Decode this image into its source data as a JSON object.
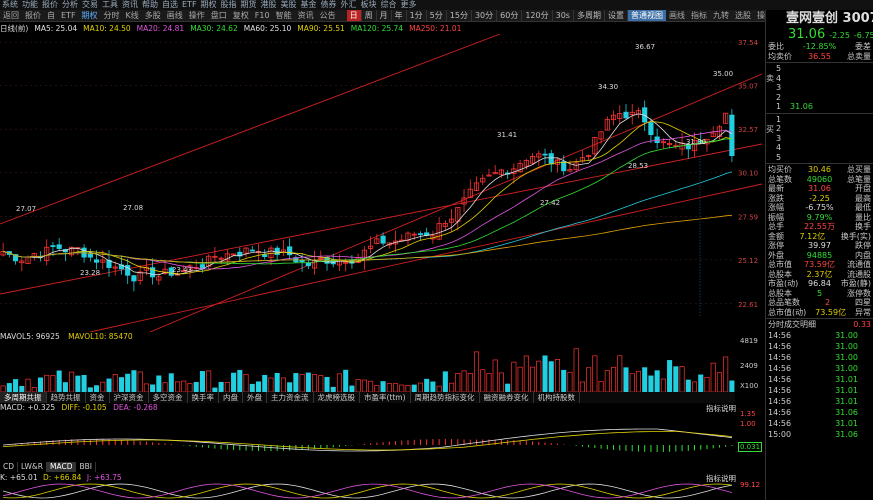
{
  "top_menu": [
    "系统",
    "功能",
    "报价",
    "分析",
    "交易",
    "工具",
    "资讯",
    "帮助",
    "自选",
    "ETF",
    "期权",
    "股指",
    "期货",
    "港股",
    "美股",
    "基金",
    "债券",
    "外汇",
    "板块",
    "综合",
    "更多"
  ],
  "toolbar": {
    "buttons": [
      "返回",
      "报价",
      "自",
      "ETF",
      "期权",
      "分时",
      "K线",
      "多股",
      "画线",
      "操作",
      "盘口",
      "复权",
      "F10",
      "智能",
      "资讯",
      "公告"
    ],
    "periods": [
      "日",
      "周",
      "月",
      "年",
      "1分",
      "5分",
      "15分",
      "30分",
      "60分",
      "120分",
      "30s",
      "多周期",
      "设置"
    ],
    "right_buttons": [
      "普通视图",
      "画线",
      "指标",
      "九转",
      "选股",
      "操作",
      "内",
      "盘口",
      "指数",
      "区间",
      "更多"
    ]
  },
  "ma_header": {
    "prefix": "日线(前)",
    "items": [
      {
        "label": "MA5: 25.04",
        "color": "#e0e0e0"
      },
      {
        "label": "MA10: 24.50",
        "color": "#e0d000"
      },
      {
        "label": "MA20: 24.81",
        "color": "#e055e0"
      },
      {
        "label": "MA30: 24.62",
        "color": "#33dd33"
      },
      {
        "label": "MA60: 25.10",
        "color": "#e0e0e0"
      },
      {
        "label": "MA90: 25.51",
        "color": "#e0d000"
      },
      {
        "label": "MA120: 25.74",
        "color": "#33dd33"
      },
      {
        "label": "MA250: 21.01",
        "color": "#ff4444"
      }
    ]
  },
  "price_axis": [
    "37.54",
    "35.07",
    "32.57",
    "30.10",
    "27.59",
    "25.12",
    "22.61"
  ],
  "annotations": [
    "36.67",
    "35.00",
    "34.30",
    "31.41",
    "31.00",
    "28.53",
    "27.42",
    "27.07",
    "27.08",
    "23.28",
    "23.43"
  ],
  "volume_header": {
    "mavol5": "MAVOL5: 96925",
    "mavol10": "MAVOL10: 85470"
  },
  "volume_axis": [
    "4819",
    "2409",
    "X100"
  ],
  "indicator_tabs": [
    "多周期共振",
    "趋势共振",
    "资金",
    "沪深资金",
    "多空资金",
    "换手率",
    "内盘",
    "外盘",
    "主力资金流",
    "龙虎榜选股",
    "市盈率(ttm)",
    "周期趋势指标变化",
    "融资融券变化",
    "机构持股数"
  ],
  "tab_right_label": "指标说明",
  "macd_header": {
    "macd": "MACD: +0.325",
    "diff": "DIFF: -0.105",
    "dea": "DEA: -0.268"
  },
  "macd_axis": [
    "1.35",
    "1.00",
    "0.031"
  ],
  "kdj_tabs": [
    "CD",
    "LW&R",
    "MACD",
    "BBI"
  ],
  "kdj_header": {
    "k": "K: +65.01",
    "d": "D: +66.84",
    "j": "J: +63.75"
  },
  "kdj_axis": "99.12",
  "kdj_right_label": "指标说明",
  "date_label": "时间段",
  "right_panel": {
    "title": "壹网壹创 300792",
    "price": "31.06",
    "change": "-2.25",
    "change_pct": "-6.75%",
    "webi_label": "委比",
    "webi_value": "-12.85%",
    "weicha_label": "委差",
    "buy_label": "买",
    "sell_label": "卖",
    "avg_label": "均卖价",
    "avg_value": "36.55",
    "total_label": "总卖量",
    "asks": [
      {
        "lvl": "5",
        "price": "",
        "vol": ""
      },
      {
        "lvl": "4",
        "price": "",
        "vol": ""
      },
      {
        "lvl": "3",
        "price": "",
        "vol": ""
      },
      {
        "lvl": "2",
        "price": "",
        "vol": ""
      },
      {
        "lvl": "1",
        "price": "31.06",
        "vol": ""
      }
    ],
    "bids": [
      {
        "lvl": "1",
        "price": "",
        "vol": ""
      },
      {
        "lvl": "2",
        "price": "",
        "vol": ""
      },
      {
        "lvl": "3",
        "price": "",
        "vol": ""
      },
      {
        "lvl": "4",
        "price": "",
        "vol": ""
      },
      {
        "lvl": "5",
        "price": "",
        "vol": ""
      }
    ],
    "avg_buy_label": "均买价",
    "avg_buy_value": "30.46",
    "total_buy_label": "总买量",
    "stats": [
      {
        "k": "总笔数",
        "v": "49060",
        "k2": "总笔量"
      },
      {
        "k": "最新",
        "v": "31.06",
        "k2": "开盘"
      },
      {
        "k": "涨跌",
        "v": "-2.25",
        "k2": "最高"
      },
      {
        "k": "涨幅",
        "v": "-6.75%",
        "k2": "最低"
      },
      {
        "k": "振幅",
        "v": "9.79%",
        "k2": "量比"
      },
      {
        "k": "总手",
        "v": "22.55万",
        "k2": "换手"
      },
      {
        "k": "金额",
        "v": "7.12亿",
        "k2": "换手(实)"
      },
      {
        "k": "涨停",
        "v": "39.97",
        "k2": "跌停"
      },
      {
        "k": "外盘",
        "v": "94885",
        "k2": "内盘"
      },
      {
        "k": "总市值",
        "v": "73.59亿",
        "k2": "流通值"
      },
      {
        "k": "总股本",
        "v": "2.37亿",
        "k2": "流通股"
      },
      {
        "k": "市盈(动)",
        "v": "96.84",
        "k2": "市盈(静)"
      },
      {
        "k": "总股本",
        "v": "5",
        "k2": "涨停数"
      },
      {
        "k": "总品笔数",
        "v": "2",
        "k2": "四星"
      },
      {
        "k": "总市值(动)",
        "v": "73.59亿",
        "k2": "异常"
      }
    ],
    "tick_header": "分时成交明细",
    "tick_extra": "0.33",
    "ticks": [
      {
        "t": "14:56",
        "p": "31.00"
      },
      {
        "t": "14:56",
        "p": "31.00"
      },
      {
        "t": "14:56",
        "p": "31.00"
      },
      {
        "t": "14:56",
        "p": "31.00"
      },
      {
        "t": "14:56",
        "p": "31.01"
      },
      {
        "t": "14:56",
        "p": "31.01"
      },
      {
        "t": "14:56",
        "p": "31.01"
      },
      {
        "t": "14:56",
        "p": "31.06"
      },
      {
        "t": "14:56",
        "p": "31.01"
      },
      {
        "t": "15:00",
        "p": "31.06"
      }
    ]
  },
  "bottom_label": "时间段",
  "chart_data": {
    "type": "candlestick",
    "ylim": [
      21.0,
      38.0
    ],
    "annotations_values": [
      36.67,
      35.0,
      34.3,
      31.41,
      31.0,
      28.53,
      27.42,
      27.07,
      27.08,
      23.28,
      23.43
    ],
    "last_close": 31.06
  }
}
